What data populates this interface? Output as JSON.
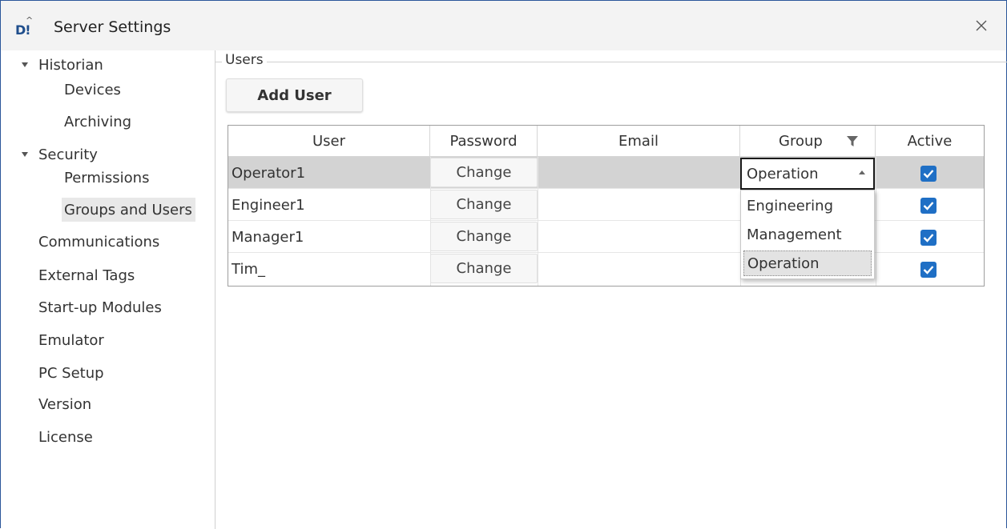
{
  "window": {
    "title": "Server Settings",
    "icon_name": "app-logo-icon",
    "close_icon": "close-icon"
  },
  "sidebar": {
    "items": [
      {
        "label": "Historian",
        "expanded": true
      },
      {
        "label": "Devices"
      },
      {
        "label": "Archiving"
      },
      {
        "label": "Security",
        "expanded": true
      },
      {
        "label": "Permissions"
      },
      {
        "label": "Groups and Users",
        "selected": true
      },
      {
        "label": "Communications"
      },
      {
        "label": "External Tags"
      },
      {
        "label": "Start-up Modules"
      },
      {
        "label": "Emulator"
      },
      {
        "label": "PC Setup"
      },
      {
        "label": "Version"
      },
      {
        "label": "License"
      }
    ]
  },
  "users_panel": {
    "legend": "Users",
    "add_user_label": "Add User",
    "columns": [
      "User",
      "Password",
      "Email",
      "Group",
      "Active"
    ],
    "filter_icon": "filter-icon",
    "change_label": "Change",
    "rows": [
      {
        "user": "Operator1",
        "email": "",
        "group": "Operation",
        "active": true
      },
      {
        "user": "Engineer1",
        "email": "",
        "active": true
      },
      {
        "user": "Manager1",
        "email": "",
        "active": true
      },
      {
        "user": "Tim_",
        "email": "",
        "active": true
      }
    ],
    "group_dropdown": {
      "options": [
        "Engineering",
        "Management",
        "Operation"
      ],
      "selected": "Operation"
    }
  },
  "colors": {
    "accent": "#1f6fc5",
    "selected_row": "#d3d3d3",
    "window_border": "#2b579a"
  }
}
